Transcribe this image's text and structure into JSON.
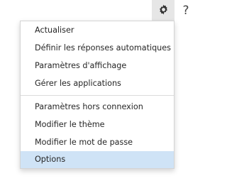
{
  "toolbar": {
    "settings_icon": "gear-icon",
    "help_label": "?"
  },
  "menu": {
    "group1": [
      {
        "label": "Actualiser"
      },
      {
        "label": "Définir les réponses automatiques"
      },
      {
        "label": "Paramètres d'affichage"
      },
      {
        "label": "Gérer les applications"
      }
    ],
    "group2": [
      {
        "label": "Paramètres hors connexion"
      },
      {
        "label": "Modifier le thème"
      },
      {
        "label": "Modifier le mot de passe"
      },
      {
        "label": "Options",
        "selected": true
      }
    ]
  },
  "colors": {
    "selected_bg": "#cfe3f6",
    "settings_button_bg": "#e6e6e6",
    "text": "#262626"
  }
}
